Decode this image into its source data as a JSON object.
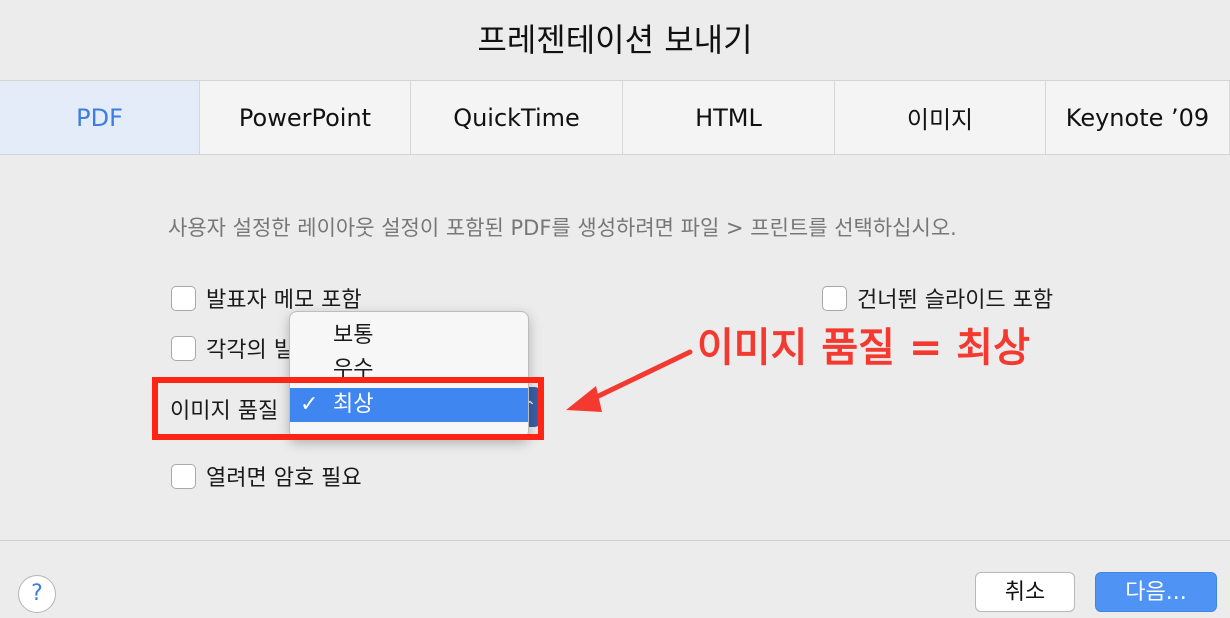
{
  "dialog": {
    "title": "프레젠테이션 보내기"
  },
  "tabs": [
    {
      "label": "PDF"
    },
    {
      "label": "PowerPoint"
    },
    {
      "label": "QuickTime"
    },
    {
      "label": "HTML"
    },
    {
      "label": "이미지"
    },
    {
      "label": "Keynote ’09"
    }
  ],
  "description": "사용자 설정한 레이아웃 설정이 포함된 PDF를 생성하려면 파일 > 프린트를 선택하십시오.",
  "options": {
    "presenter_notes": "발표자 메모 포함",
    "each_build": "각각의 빌",
    "skipped_slides": "건너뛴 슬라이드 포함",
    "require_password": "열려면 암호 필요"
  },
  "image_quality": {
    "label": "이미지 품질",
    "items": [
      "보통",
      "우수",
      "최상"
    ],
    "selected": "최상"
  },
  "annotation": {
    "text": "이미지 품질 = 최상",
    "color": "#f43a30"
  },
  "footer": {
    "help": "?",
    "cancel": "취소",
    "next": "다음..."
  },
  "colors": {
    "accent": "#3b7de0",
    "highlight": "#ff2414"
  }
}
